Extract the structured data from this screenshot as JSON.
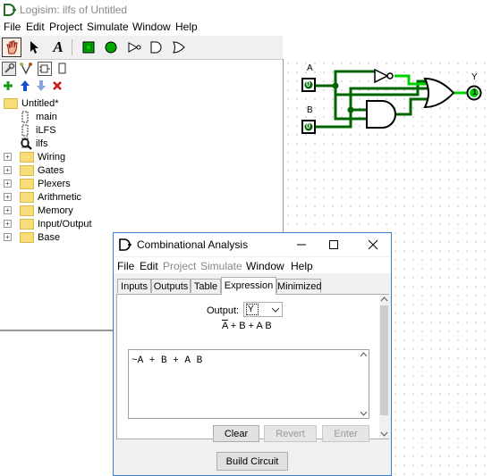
{
  "app": {
    "title": "Logisim: ilfs of Untitled",
    "menu": [
      "File",
      "Edit",
      "Project",
      "Simulate",
      "Window",
      "Help"
    ]
  },
  "toolbar": {
    "tools": [
      "poke-tool",
      "select-tool",
      "text-tool",
      "input-pin",
      "output-pin",
      "not-gate",
      "and-gate",
      "or-gate"
    ],
    "text_tool_glyph": "A"
  },
  "explorer": {
    "project": "Untitled*",
    "circuits": [
      "main",
      "iLFS",
      "ilfs"
    ],
    "libraries": [
      "Wiring",
      "Gates",
      "Plexers",
      "Arithmetic",
      "Memory",
      "Input/Output",
      "Base"
    ]
  },
  "canvas": {
    "pin_a_label": "A",
    "pin_b_label": "B",
    "output_label": "Y",
    "pin_a_value": "0",
    "pin_b_value": "0",
    "output_value": "1"
  },
  "dialog": {
    "title": "Combinational Analysis",
    "menu": [
      {
        "label": "File",
        "enabled": true
      },
      {
        "label": "Edit",
        "enabled": true
      },
      {
        "label": "Project",
        "enabled": false
      },
      {
        "label": "Simulate",
        "enabled": false
      },
      {
        "label": "Window",
        "enabled": true
      },
      {
        "label": "Help",
        "enabled": true
      }
    ],
    "tabs": [
      "Inputs",
      "Outputs",
      "Table",
      "Expression",
      "Minimized"
    ],
    "active_tab": "Expression",
    "output_label": "Output:",
    "output_value": "Y",
    "expression_display": {
      "overbar": "A",
      "rest": " + B + A B"
    },
    "expression_text": "~A + B + A B",
    "buttons": {
      "clear": "Clear",
      "revert": "Revert",
      "enter": "Enter",
      "build": "Build Circuit"
    }
  },
  "colors": {
    "wire_true": "#00d200",
    "wire_false": "#006400",
    "dialog_border": "#3b7ec9"
  }
}
